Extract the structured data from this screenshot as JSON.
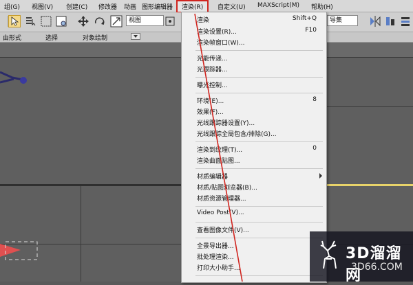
{
  "menubar": {
    "items": [
      {
        "label": "组(G)"
      },
      {
        "label": "视图(V)"
      },
      {
        "label": "创建(C)"
      },
      {
        "label": "修改器"
      },
      {
        "label": "动画"
      },
      {
        "label": "图形编辑器"
      },
      {
        "label": "渲染(R)"
      },
      {
        "label": "自定义(U)"
      },
      {
        "label": "MAXScript(M)"
      },
      {
        "label": "帮助(H)"
      }
    ]
  },
  "toolbar": {
    "view_select": "视图",
    "right_select": "导集"
  },
  "subtoolbar": {
    "labels": [
      "由形式",
      "选择",
      "对象绘制"
    ]
  },
  "render_menu": {
    "items": [
      {
        "label": "渲染",
        "shortcut": "Shift+Q"
      },
      {
        "label": "渲染设置(R)...",
        "shortcut": "F10"
      },
      {
        "label": "渲染帧窗口(W)...",
        "shortcut": ""
      },
      {
        "label": "光能传递...",
        "shortcut": ""
      },
      {
        "label": "光跟踪器...",
        "shortcut": ""
      },
      {
        "label": "曝光控制...",
        "shortcut": ""
      },
      {
        "label": "环境(E)...",
        "shortcut": "8"
      },
      {
        "label": "效果(F)...",
        "shortcut": ""
      },
      {
        "label": "光线跟踪器设置(Y)...",
        "shortcut": ""
      },
      {
        "label": "光线跟踪全局包含/排除(G)...",
        "shortcut": ""
      },
      {
        "label": "渲染到纹理(T)...",
        "shortcut": "0"
      },
      {
        "label": "渲染曲面贴图...",
        "shortcut": ""
      },
      {
        "label": "材质编辑器",
        "shortcut": ""
      },
      {
        "label": "材质/贴图浏览器(B)...",
        "shortcut": ""
      },
      {
        "label": "材质资源管理器...",
        "shortcut": ""
      },
      {
        "label": "Video Post(V)...",
        "shortcut": ""
      },
      {
        "label": "查看图像文件(V)...",
        "shortcut": ""
      },
      {
        "label": "全景导出器...",
        "shortcut": ""
      },
      {
        "label": "批处理渲染...",
        "shortcut": ""
      },
      {
        "label": "打印大小助手...",
        "shortcut": ""
      }
    ]
  },
  "watermark": {
    "logo_text": "3D溜溜网",
    "site_text": "3D66.COM"
  },
  "colors": {
    "highlight_border": "#d0251f"
  }
}
